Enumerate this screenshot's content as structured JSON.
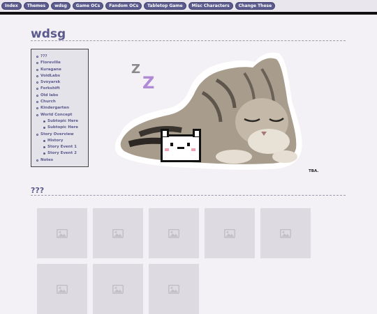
{
  "nav": {
    "items": [
      "Index",
      "Themes",
      "wdsg",
      "Game OCs",
      "Fandom OCs",
      "Tabletop Game",
      "Misc Characters",
      "Change These"
    ]
  },
  "page": {
    "title": "wdsg"
  },
  "toc": [
    {
      "label": "???",
      "level": 1
    },
    {
      "label": "Floreville",
      "level": 1
    },
    {
      "label": "Kuragane",
      "level": 1
    },
    {
      "label": "VoidLabs",
      "level": 1
    },
    {
      "label": "Svoyarsk",
      "level": 1
    },
    {
      "label": "Forkshift",
      "level": 1
    },
    {
      "label": "Old labs",
      "level": 1
    },
    {
      "label": "Church",
      "level": 1
    },
    {
      "label": "Kindergarten",
      "level": 1
    },
    {
      "label": "World Concept",
      "level": 1
    },
    {
      "label": "Subtopic Here",
      "level": 2
    },
    {
      "label": "Subtopic Here",
      "level": 2
    },
    {
      "label": "Story Overview",
      "level": 1
    },
    {
      "label": "History",
      "level": 2
    },
    {
      "label": "Story Event 1",
      "level": 2
    },
    {
      "label": "Story Event 2",
      "level": 2
    },
    {
      "label": "Notes",
      "level": 1
    }
  ],
  "banner": {
    "zz_text": "Z Z",
    "caption": "TBA."
  },
  "section": {
    "title": "???"
  },
  "gallery": {
    "count": 8,
    "icon": "image-placeholder-icon"
  },
  "colors": {
    "accent": "#5a5a8c",
    "nav_bg": "#5b5b8e",
    "page_bg": "#f3f1f6",
    "zz": "#b18ad6"
  }
}
